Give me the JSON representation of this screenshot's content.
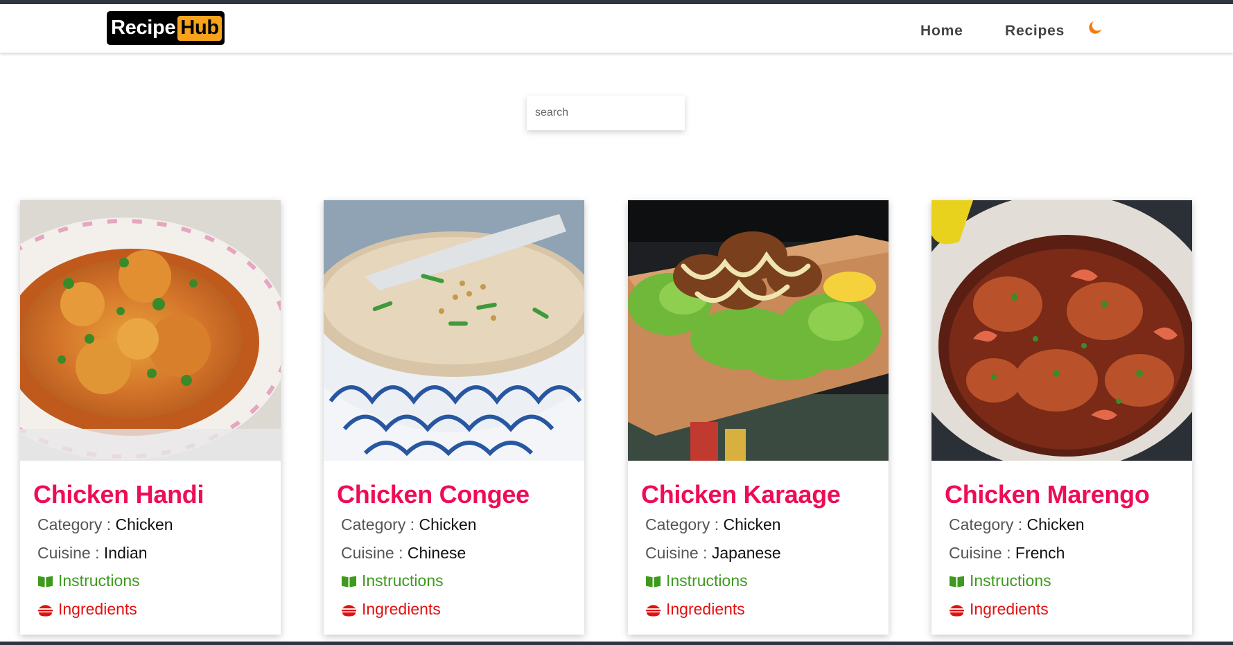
{
  "logo": {
    "part1": "Recipe",
    "part2": "Hub"
  },
  "nav": {
    "home": "Home",
    "recipes": "Recipes"
  },
  "search": {
    "placeholder": "search",
    "value": ""
  },
  "labels": {
    "category": "Category",
    "cuisine": "Cuisine",
    "instructions": "Instructions",
    "ingredients": "Ingredients",
    "separator": " : "
  },
  "colors": {
    "title": "#ee0d55",
    "instructions": "#3d9a1d",
    "ingredients": "#e01010",
    "logo_accent": "#f7a21b",
    "theme_icon": "#f07c13"
  },
  "icons": {
    "theme": "moon-icon",
    "instructions": "book-open-icon",
    "ingredients": "burger-icon"
  },
  "recipes": [
    {
      "title": "Chicken Handi",
      "category": "Chicken",
      "cuisine": "Indian"
    },
    {
      "title": "Chicken Congee",
      "category": "Chicken",
      "cuisine": "Chinese"
    },
    {
      "title": "Chicken Karaage",
      "category": "Chicken",
      "cuisine": "Japanese"
    },
    {
      "title": "Chicken Marengo",
      "category": "Chicken",
      "cuisine": "French"
    }
  ]
}
